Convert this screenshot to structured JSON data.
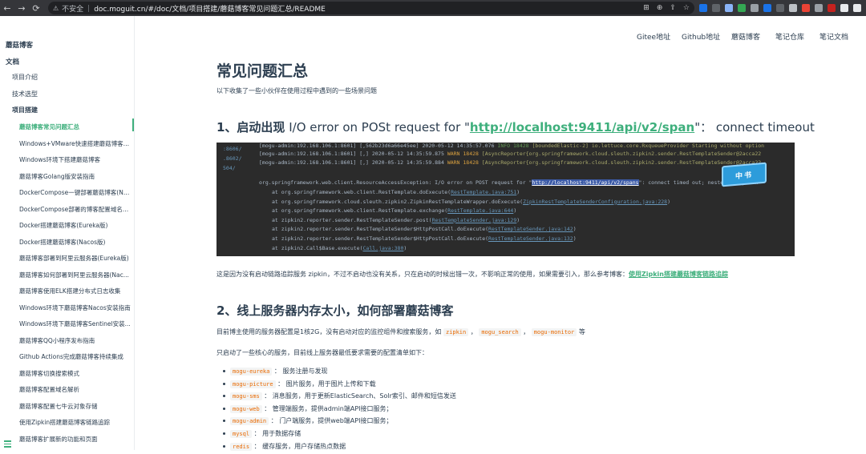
{
  "browser": {
    "url": "doc.moguit.cn/#/doc/文档/项目搭建/蘑菇博客常见问题汇总/README",
    "security_label": "不安全"
  },
  "sidebar": {
    "site_title": "蘑菇博客",
    "section": "文档",
    "items": [
      "项目介绍",
      "技术选型",
      "项目搭建"
    ],
    "sub_items": [
      "蘑菇博客常见问题汇总",
      "Windows+VMware快速搭建蘑菇博客本...",
      "Windows环境下搭建蘑菇博客",
      "蘑菇博客Golang版安装指南",
      "DockerCompose一键部署蘑菇博客(Nac...",
      "DockerCompose部署的博客配置域名访...",
      "Docker搭建蘑菇博客(Eureka版)",
      "Docker搭建蘑菇博客(Nacos版)",
      "蘑菇博客部署到阿里云服务器(Eureka版)",
      "蘑菇博客如何部署到阿里云服务器(Nac...",
      "蘑菇博客使用ELK搭建分布式日志收集",
      "Windows环境下蘑菇博客Nacos安装指南",
      "Windows环境下蘑菇博客Sentinel安装...",
      "蘑菇博客QQ小程序发布指南",
      "Github Actions完成蘑菇博客持续集成",
      "蘑菇博客切换搜索模式",
      "蘑菇博客配置域名解析",
      "蘑菇博客配置七牛云对象存储",
      "使用Zipkin搭建蘑菇博客链路追踪",
      "蘑菇博客扩展新的功能和页面"
    ]
  },
  "top_nav": [
    "Gitee地址",
    "Github地址",
    "蘑菇博客",
    "笔记仓库",
    "笔记文档"
  ],
  "main": {
    "title": "常见问题汇总",
    "intro": "以下收集了一些小伙伴在使用过程中遇到的一些场景问题",
    "section1": {
      "heading_prefix": "1、启动出现",
      "heading_error": " I/O error on POSt request for \"",
      "heading_link": "http://localhost:9411/api/v2/span",
      "heading_suffix": "\"： connect timeout",
      "screenshot": {
        "gutter": [
          ":8606/",
          ".8602/",
          "504/"
        ],
        "log_lines": [
          "[mogu-admin:192.168.106.1:8601] [,562b23d6a66e45ee] 2020-05-12 14:35:57.076 ",
          "[mogu-admin:192.168.106.1:8601] [,] 2020-05-12 14:35:59.875 ",
          "[mogu-admin:192.168.106.1:8601] [,] 2020-05-12 14:35:59.884 "
        ],
        "log_levels": [
          "INFO 18428 ",
          "WARN 18428 ",
          "WARN 18428 "
        ],
        "log_tails": [
          "[boundedElastic-2] io.lettuce.core.RxqueueProvider Starting without option",
          "[AsyncReporter{org.springframework.cloud.sleuth.zipkin2.sender.RestTemplateSender@2acca22",
          "[AsyncReporter{org.springframework.cloud.sleuth.zipkin2.sender.RestTemplateSender@2acca22"
        ],
        "exception_prefix": "org.springframework.web.client.ResourceAccessException: I/O error on POST request for \"",
        "exception_url": "http://localhost:9411/api/v2/spans",
        "exception_suffix": "\": connect timed out; nested exception",
        "stack": [
          [
            "at org.springframework.web.client.RestTemplate.doExecute(",
            "RestTemplate.java:751",
            ")"
          ],
          [
            "at org.springframework.cloud.sleuth.zipkin2.ZipkinRestTemplateWrapper.doExecute(",
            "ZipkinRestTemplateSenderConfiguration.java:228",
            ")"
          ],
          [
            "at org.springframework.web.client.RestTemplate.exchange(",
            "RestTemplate.java:644",
            ")"
          ],
          [
            "at zipkin2.reporter.sender.RestTemplateSender.post(",
            "RestTemplateSender.java:129",
            ")"
          ],
          [
            "at zipkin2.reporter.sender.RestTemplateSender$HttpPostCall.doExecute(",
            "RestTemplateSender.java:142",
            ")"
          ],
          [
            "at zipkin2.reporter.sender.RestTemplateSender$HttpPostCall.doExecute(",
            "RestTemplateSender.java:132",
            ")"
          ],
          [
            "at zipkin2.Call$Base.execute(",
            "Call.java:380",
            ")"
          ]
        ],
        "badge": "中书"
      },
      "text_prefix": "这是因为没有启动链路追踪服务 zipkin，不过不启动也没有关系，只在启动的时候出错一次，不影响正常的使用，如果需要引入，那么参考博客：",
      "text_link": "使用Zipkin搭建蘑菇博客链路追踪"
    },
    "section2": {
      "heading": "2、线上服务器内存太小，如何部署蘑菇博客",
      "p1_prefix": "目前博主使用的服务器配置是1核2G，没有启动对应的监控组件和搜索服务，如",
      "p1_codes": [
        "zipkin",
        "mogu_search",
        "mogu-monitor"
      ],
      "p1_seps": [
        " ，",
        " ，",
        " 等"
      ],
      "p2": "只启动了一些核心的服务，目前线上服务器最低要求需要的配置清单如下：",
      "list": [
        {
          "code": "mogu-eureka",
          "text": " ： 服务注册与发现"
        },
        {
          "code": "mogu-picture",
          "text": " ： 图片服务，用于图片上传和下载"
        },
        {
          "code": "mogu-sms",
          "text": " ： 消息服务，用于更新ElasticSearch、Solr索引、邮件和短信发送"
        },
        {
          "code": "mogu-web",
          "text": " ： 管理端服务，提供admin端API接口服务；"
        },
        {
          "code": "mogu-admin",
          "text": " ： 门户端服务，提供web端API接口服务；"
        },
        {
          "code": "mysql",
          "text": " ： 用于数据存储"
        },
        {
          "code": "redis",
          "text": " ： 缓存服务，用户存储热点数据"
        }
      ]
    }
  }
}
